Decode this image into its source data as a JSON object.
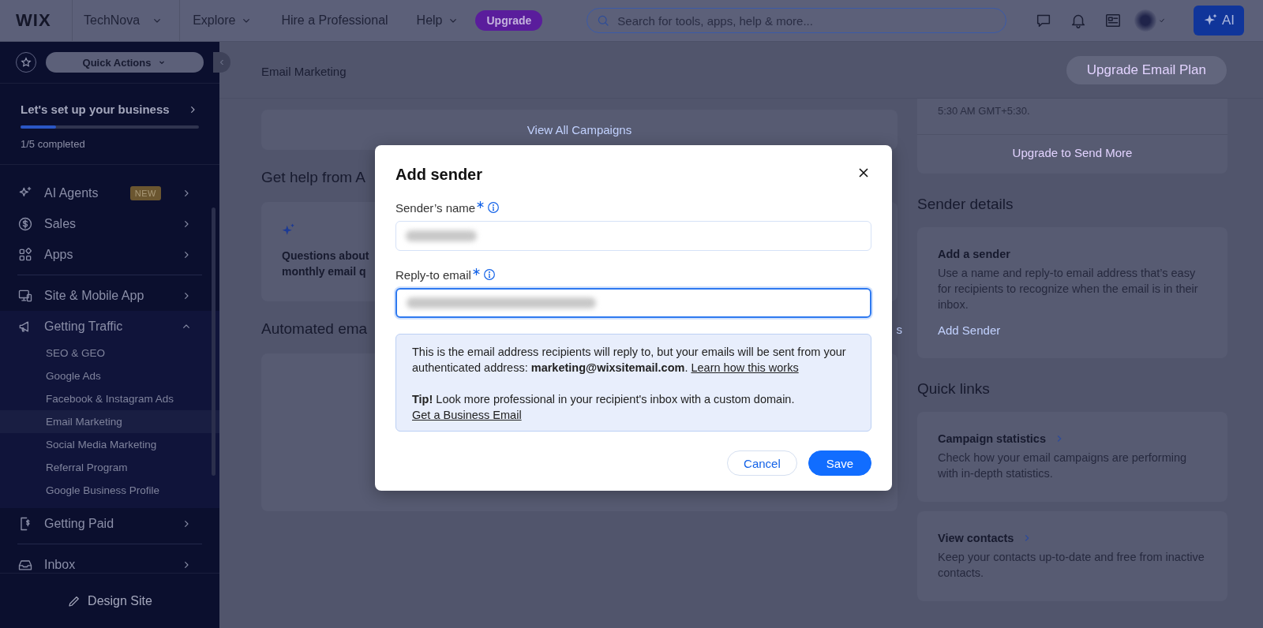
{
  "topbar": {
    "logo": "WIX",
    "site": "TechNova",
    "nav": [
      {
        "label": "Explore",
        "dropdown": true
      },
      {
        "label": "Hire a Professional",
        "dropdown": false
      },
      {
        "label": "Help",
        "dropdown": true
      }
    ],
    "upgrade": "Upgrade",
    "search": {
      "placeholder": "Search for tools, apps, help & more..."
    },
    "ai_button": "AI"
  },
  "sidebar": {
    "quick_actions": "Quick Actions",
    "setup": {
      "title": "Let's set up your business",
      "level": 0.2,
      "progress": "1/5 completed"
    },
    "items": [
      {
        "label": "AI Agents",
        "badge": "NEW",
        "expanded": false
      },
      {
        "label": "Sales",
        "expanded": false
      },
      {
        "label": "Apps",
        "expanded": false,
        "divider_after": true
      },
      {
        "label": "Site & Mobile App",
        "expanded": false
      },
      {
        "label": "Getting Traffic",
        "expanded": true,
        "children": [
          {
            "label": "SEO & GEO",
            "selected": false
          },
          {
            "label": "Google Ads",
            "selected": false
          },
          {
            "label": "Facebook & Instagram Ads",
            "selected": false
          },
          {
            "label": "Email Marketing",
            "selected": true
          },
          {
            "label": "Social Media Marketing",
            "selected": false
          },
          {
            "label": "Referral Program",
            "selected": false
          },
          {
            "label": "Google Business Profile",
            "selected": false
          }
        ]
      },
      {
        "label": "Getting Paid",
        "expanded": false,
        "divider_after": true
      },
      {
        "label": "Inbox",
        "expanded": false
      }
    ],
    "footer": "Design Site"
  },
  "header": {
    "title": "Email Marketing",
    "button": "Upgrade Email Plan"
  },
  "main": {
    "view_all": "View All Campaigns",
    "help_heading": "Get help from A",
    "help_lines": [
      "Questions about",
      "monthly email q"
    ],
    "automated_heading": "Automated ema",
    "automated_link": "s"
  },
  "right": {
    "balance_note": "5:30 AM GMT+5:30.",
    "upgrade_link": "Upgrade to Send More",
    "sender_heading": "Sender details",
    "sender_card": {
      "title": "Add a sender",
      "body": "Use a name and reply-to email address that’s easy for recipients to recognize when the email is in their inbox.",
      "link": "Add Sender"
    },
    "quick_heading": "Quick links",
    "quick_links": [
      {
        "title": "Campaign statistics",
        "description": "Check how your email campaigns are performing with in-depth statistics."
      },
      {
        "title": "View contacts",
        "description": "Keep your contacts up-to-date and free from inactive contacts."
      }
    ]
  },
  "modal": {
    "title": "Add sender",
    "fields": [
      {
        "label": "Sender’s name",
        "required": true,
        "focused": false
      },
      {
        "label": "Reply-to email",
        "required": true,
        "focused": true
      }
    ],
    "info": {
      "text": "This is the email address recipients will reply to, but your emails will be sent from your authenticated address: **marketing@wixsitemail.com**. ",
      "link": "Learn how this works",
      "tip": "**Tip!** Look more professional in your recipient's inbox with a custom domain.",
      "tip_link": "Get a Business Email"
    },
    "buttons": [
      {
        "label": "Cancel",
        "kind": "secondary"
      },
      {
        "label": "Save",
        "kind": "primary"
      }
    ]
  }
}
